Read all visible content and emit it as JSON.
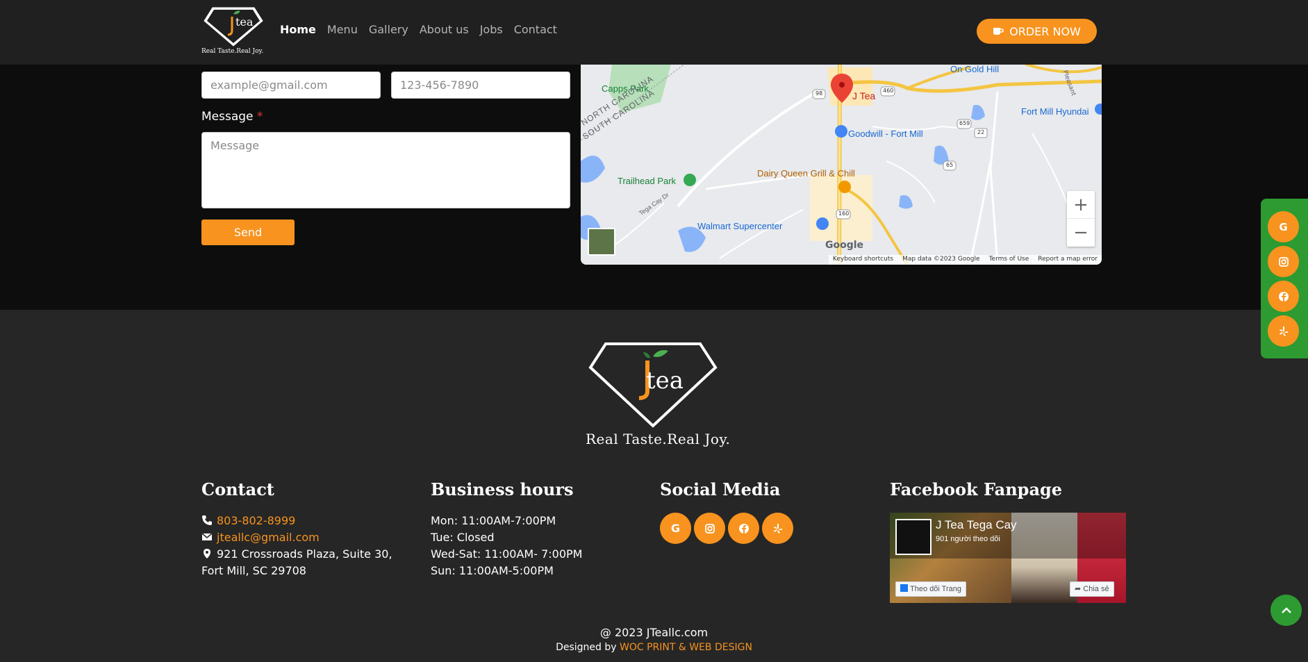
{
  "header": {
    "logo_text": "tea",
    "logo_tagline": "Real Taste.Real Joy.",
    "nav": [
      {
        "label": "Home",
        "active": true
      },
      {
        "label": "Menu",
        "active": false
      },
      {
        "label": "Gallery",
        "active": false
      },
      {
        "label": "About us",
        "active": false
      },
      {
        "label": "Jobs",
        "active": false
      },
      {
        "label": "Contact",
        "active": false
      }
    ],
    "order_label": "ORDER NOW",
    "order_icon": "coffee-cup-icon"
  },
  "form": {
    "email_placeholder": "example@gmail.com",
    "phone_placeholder": "123-456-7890",
    "message_label": "Message",
    "message_required": "*",
    "message_placeholder": "Message",
    "send_label": "Send"
  },
  "map": {
    "labels": {
      "jtea": "J Tea",
      "capps": "Capps Park",
      "gold_hill": "On Gold Hill",
      "hyundai": "Fort Mill Hyundai",
      "goodwill": "Goodwill - Fort Mill",
      "dairy": "Dairy Queen Grill & Chill",
      "trailhead": "Trailhead Park",
      "walmart": "Walmart Supercenter",
      "nc": "NORTH CAROLINA",
      "sc": "SOUTH CAROLINA",
      "tega": "Tega Cay Dr",
      "r98": "98",
      "r460": "460",
      "r659": "659",
      "r22": "22",
      "r65": "65",
      "r160": "160",
      "pleasant": "Pleasant"
    },
    "google_logo": "Google",
    "footer": [
      "Keyboard shortcuts",
      "Map data ©2023 Google",
      "Terms of Use",
      "Report a map error"
    ],
    "zoom_in": "+",
    "zoom_out": "−"
  },
  "footer": {
    "logo_text": "tea",
    "logo_tagline": "Real Taste.Real Joy.",
    "contact": {
      "title": "Contact",
      "phone": "803-802-8999",
      "email": "jteallc@gmail.com",
      "address": "921 Crossroads Plaza, Suite 30, Fort Mill, SC 29708"
    },
    "hours": {
      "title": "Business hours",
      "lines": [
        "Mon: 11:00AM-7:00PM",
        "Tue: Closed",
        "Wed-Sat: 11:00AM- 7:00PM",
        "Sun: 11:00AM-5:00PM"
      ]
    },
    "social": {
      "title": "Social Media",
      "icons": [
        "google-icon",
        "instagram-icon",
        "facebook-icon",
        "yelp-icon"
      ]
    },
    "facebook": {
      "title": "Facebook Fanpage",
      "page_name": "J Tea Tega Cay",
      "followers": "901 người theo dõi",
      "follow_label": "Theo dõi Trang",
      "share_label": "Chia sẻ"
    },
    "copyright": "@ 2023 JTeallc.com",
    "designed_by": "Designed by",
    "designer": "WOC PRINT & WEB DESIGN"
  },
  "floating": {
    "icons": [
      "google-icon",
      "instagram-icon",
      "facebook-icon",
      "yelp-icon"
    ],
    "back_to_top": "chevron-up-icon"
  },
  "colors": {
    "accent": "#f7931e",
    "green": "#2d9b32",
    "header_bg": "#202020",
    "footer_bg": "#262626"
  }
}
